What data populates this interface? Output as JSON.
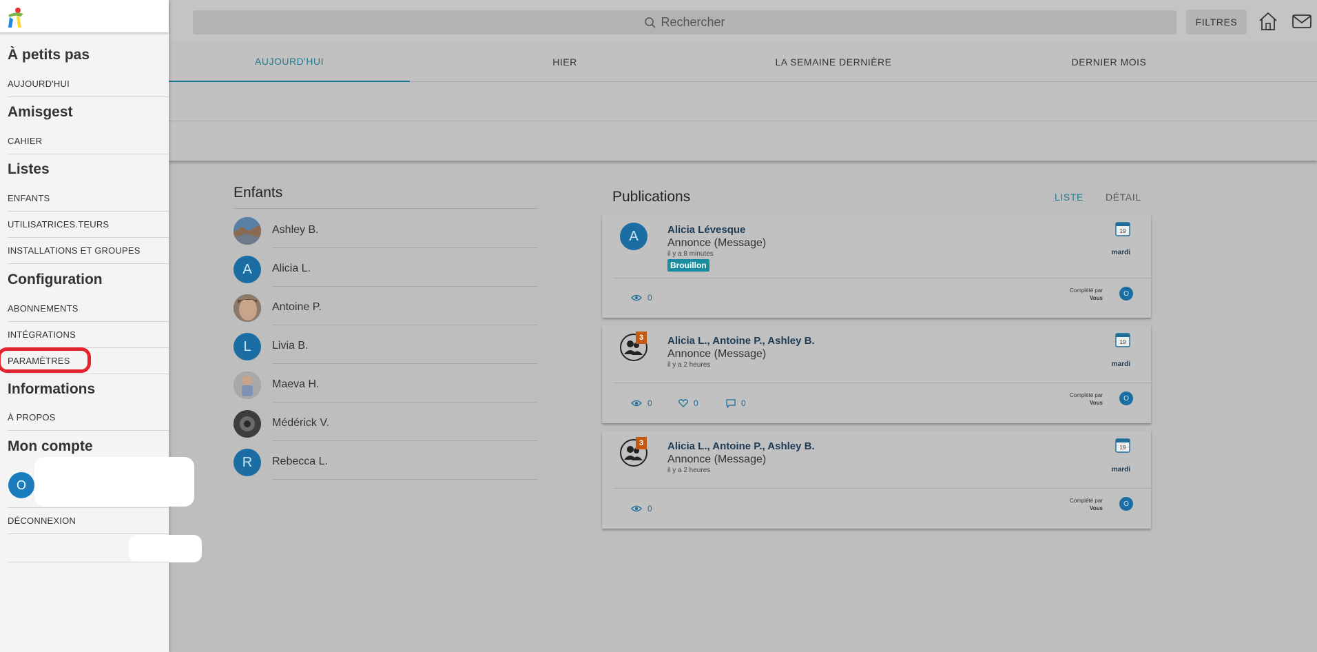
{
  "topbar": {
    "search_placeholder": "Rechercher",
    "filters_label": "FILTRES"
  },
  "tabs": [
    "AUJOURD'HUI",
    "HIER",
    "LA SEMAINE DERNIÈRE",
    "DERNIER MOIS"
  ],
  "sidebar": {
    "sections": [
      {
        "title": "À petits pas",
        "items": [
          "AUJOURD'HUI"
        ]
      },
      {
        "title": "Amisgest",
        "items": [
          "CAHIER"
        ]
      },
      {
        "title": "Listes",
        "items": [
          "ENFANTS",
          "UTILISATRICES.TEURS",
          "INSTALLATIONS ET GROUPES"
        ]
      },
      {
        "title": "Configuration",
        "items": [
          "ABONNEMENTS",
          "INTÉGRATIONS",
          "PARAMÈTRES"
        ]
      },
      {
        "title": "Informations",
        "items": [
          "À PROPOS"
        ]
      },
      {
        "title": "Mon compte",
        "items": [
          "DÉCONNEXION"
        ]
      }
    ],
    "account_initial": "O"
  },
  "enfants": {
    "title": "Enfants",
    "children": [
      {
        "name": "Ashley B.",
        "initial": "",
        "photo": "landscape"
      },
      {
        "name": "Alicia L.",
        "initial": "A",
        "photo": ""
      },
      {
        "name": "Antoine P.",
        "initial": "",
        "photo": "face"
      },
      {
        "name": "Livia B.",
        "initial": "L",
        "photo": ""
      },
      {
        "name": "Maeva H.",
        "initial": "",
        "photo": "baby"
      },
      {
        "name": "Médérick V.",
        "initial": "",
        "photo": "dark"
      },
      {
        "name": "Rebecca L.",
        "initial": "R",
        "photo": ""
      }
    ]
  },
  "publications": {
    "title": "Publications",
    "mode_list": "LISTE",
    "mode_detail": "DÉTAIL",
    "completed_by": "Complété par",
    "completed_you": "Vous",
    "cards": [
      {
        "author": "Alicia Lévesque",
        "avatar": "A",
        "group_count": "",
        "type": "Annonce (Message)",
        "ago": "il y a 8 minutes",
        "draft": "Brouillon",
        "day": "mardi",
        "calendar_day": "19",
        "views": "0",
        "likes": "",
        "comments": "",
        "completer": "O"
      },
      {
        "author": "Alicia L., Antoine P., Ashley B.",
        "avatar": "",
        "group_count": "3",
        "type": "Annonce (Message)",
        "ago": "il y a 2 heures",
        "draft": "",
        "day": "mardi",
        "calendar_day": "19",
        "views": "0",
        "likes": "0",
        "comments": "0",
        "completer": "O"
      },
      {
        "author": "Alicia L., Antoine P., Ashley B.",
        "avatar": "",
        "group_count": "3",
        "type": "Annonce (Message)",
        "ago": "il y a 2 heures",
        "draft": "",
        "day": "mardi",
        "calendar_day": "19",
        "views": "0",
        "likes": "",
        "comments": "",
        "completer": "O"
      }
    ]
  },
  "colors": {
    "accent": "#1e7c92",
    "avatar": "#1a6ea3",
    "highlight": "#e5232e",
    "badge": "#c25a12",
    "draft": "#1a8ca0"
  }
}
